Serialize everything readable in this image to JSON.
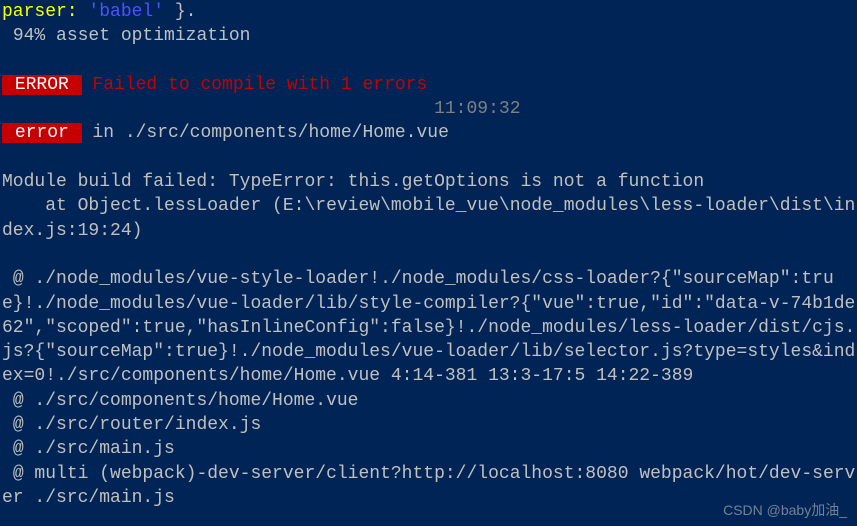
{
  "lines": {
    "parser_line_prefix": "parser:",
    "parser_line_value": " 'babel' ",
    "parser_line_suffix": "}.",
    "progress": " 94% asset optimization",
    "error_badge": " ERROR ",
    "error_msg": " Failed to compile with 1 errors",
    "timestamp": "                                        11:09:32",
    "error2_badge": " error ",
    "error2_path": " in ./src/components/home/Home.vue",
    "module_fail": "Module build failed: TypeError: this.getOptions is not a function",
    "at_line": "    at Object.lessLoader (E:\\review\\mobile_vue\\node_modules\\less-loader\\dist\\index.js:19:24)",
    "trace1": " @ ./node_modules/vue-style-loader!./node_modules/css-loader?{\"sourceMap\":true}!./node_modules/vue-loader/lib/style-compiler?{\"vue\":true,\"id\":\"data-v-74b1de62\",\"scoped\":true,\"hasInlineConfig\":false}!./node_modules/less-loader/dist/cjs.js?{\"sourceMap\":true}!./node_modules/vue-loader/lib/selector.js?type=styles&index=0!./src/components/home/Home.vue 4:14-381 13:3-17:5 14:22-389",
    "trace2": " @ ./src/components/home/Home.vue",
    "trace3": " @ ./src/router/index.js",
    "trace4": " @ ./src/main.js",
    "trace5": " @ multi (webpack)-dev-server/client?http://localhost:8080 webpack/hot/dev-server ./src/main.js",
    "watermark": "CSDN @baby加油_"
  }
}
